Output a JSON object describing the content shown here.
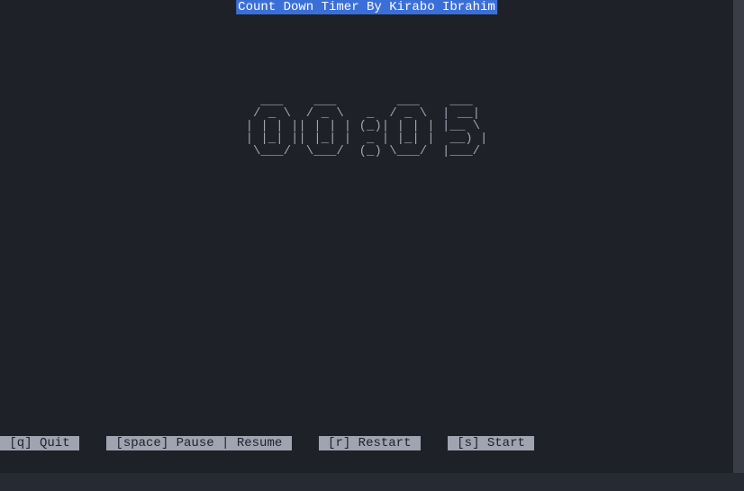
{
  "title": "Count Down Timer By Kirabo Ibrahim",
  "timer_ascii": "  ___    ___        ___    ___ \n / _ \\  / _ \\   _  / _ \\  | __|\n| | | || | | | (_)| | | | |__ \\\n| |_| || |_| |  _ | |_| |  __) |\n \\___/  \\___/  (_) \\___/  |___/",
  "timer_value": "00:05",
  "footer": {
    "quit": " [q] Quit ",
    "pause": " [space] Pause | Resume ",
    "restart": " [r] Restart ",
    "start": " [s] Start "
  }
}
